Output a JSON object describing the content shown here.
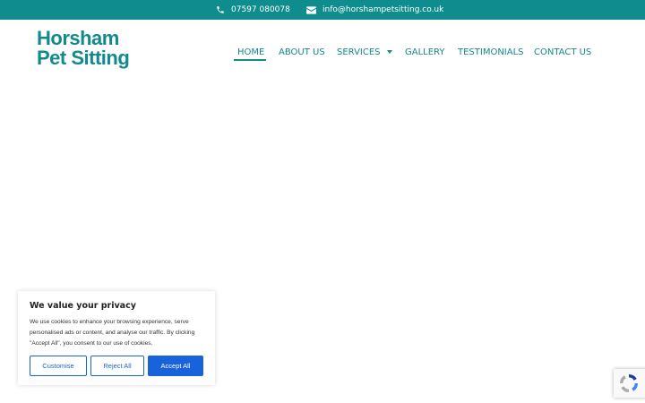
{
  "topbar": {
    "phone": "07597 080078",
    "email": "info@horshampetsitting.co.uk",
    "bg_color": "#0f8c8e"
  },
  "logo": {
    "line1": "Horsham",
    "line2": "Pet Sitting",
    "color": "#128a8c"
  },
  "nav": {
    "home": "HOME",
    "about": "ABOUT US",
    "services": "SERVICES",
    "gallery": "GALLERY",
    "testimonials": "TESTIMONIALS",
    "contact": "CONTACT US",
    "active": "HOME"
  },
  "cookie_banner": {
    "title": "We value your privacy",
    "text": "We use cookies to enhance your browsing experience, serve personalised ads or content, and analyse our traffic. By clicking \"Accept All\", you consent to our use of cookies.",
    "customise": "Customise",
    "reject": "Reject All",
    "accept": "Accept All",
    "accent_color": "#1863dc"
  },
  "icons": {
    "phone": "phone-icon",
    "email": "envelope-icon",
    "recaptcha": "recaptcha-icon"
  }
}
